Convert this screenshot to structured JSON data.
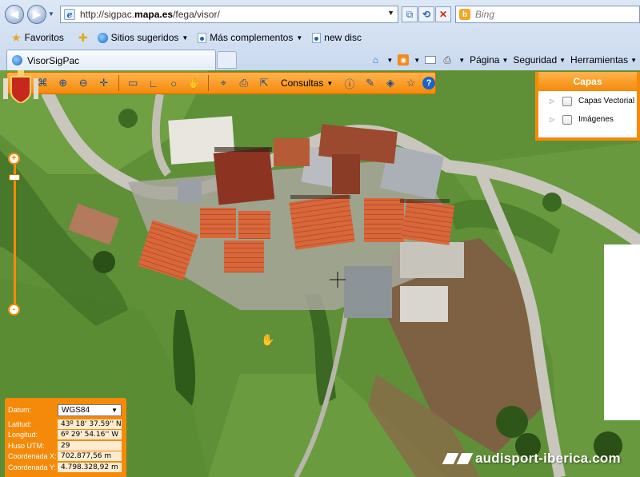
{
  "browser": {
    "url_prefix": "http://sigpac.",
    "url_domain": "mapa.es",
    "url_suffix": "/fega/visor/",
    "search_placeholder": "Bing",
    "favorites": {
      "label": "Favoritos",
      "items": [
        "Sitios sugeridos",
        "Más complementos",
        "new disc"
      ]
    },
    "tab_title": "VisorSigPac",
    "command_menus": [
      "Página",
      "Seguridad",
      "Herramientas"
    ]
  },
  "toolbar": {
    "consultas_label": "Consultas",
    "help_label": "?"
  },
  "layers": {
    "title": "Capas",
    "items": [
      "Capas Vectorial",
      "Imágenes"
    ]
  },
  "zoom": {
    "in_label": "+",
    "out_label": "-"
  },
  "coords": {
    "datum_label": "Datum:",
    "datum_value": "WGS84",
    "latitud_label": "Latitud:",
    "latitud_value": "43º 18' 37.59'' N",
    "longitud_label": "Longitud:",
    "longitud_value": "6º 29' 54.16'' W",
    "huso_label": "Huso UTM:",
    "huso_value": "29",
    "coord_x_label": "Coordenada X:",
    "coord_x_value": "702.877,56 m",
    "coord_y_label": "Coordenada Y:",
    "coord_y_value": "4.798.328,92 m"
  },
  "watermark": {
    "text": "audisport-iberica.com"
  },
  "colors": {
    "accent_orange": "#f58a0a",
    "chrome_blue": "#c9d9ee"
  }
}
